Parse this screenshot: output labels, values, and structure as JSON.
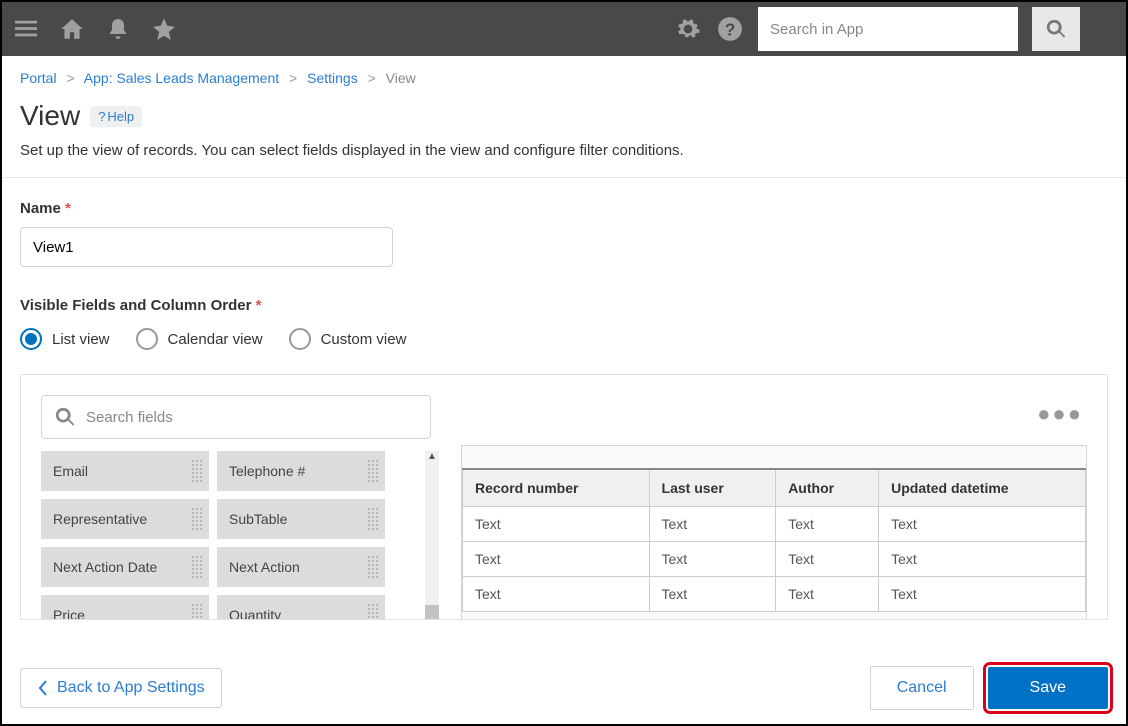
{
  "header": {
    "search_placeholder": "Search in App"
  },
  "breadcrumb": {
    "portal": "Portal",
    "app": "App: Sales Leads Management",
    "settings": "Settings",
    "current": "View"
  },
  "page": {
    "title": "View",
    "help": "Help",
    "subtitle": "Set up the view of records. You can select fields displayed in the view and configure filter conditions."
  },
  "form": {
    "name_label": "Name",
    "name_value": "View1",
    "visible_label": "Visible Fields and Column Order",
    "radios": {
      "list": "List view",
      "calendar": "Calendar view",
      "custom": "Custom view"
    },
    "search_fields_placeholder": "Search fields"
  },
  "chips": [
    "Email",
    "Telephone #",
    "Representative",
    "SubTable",
    "Next Action Date",
    "Next Action",
    "Price",
    "Quantity"
  ],
  "table": {
    "headers": [
      "Record number",
      "Last user",
      "Author",
      "Updated datetime"
    ],
    "rows": [
      [
        "Text",
        "Text",
        "Text",
        "Text"
      ],
      [
        "Text",
        "Text",
        "Text",
        "Text"
      ],
      [
        "Text",
        "Text",
        "Text",
        "Text"
      ]
    ]
  },
  "footer": {
    "back": "Back to App Settings",
    "cancel": "Cancel",
    "save": "Save"
  }
}
